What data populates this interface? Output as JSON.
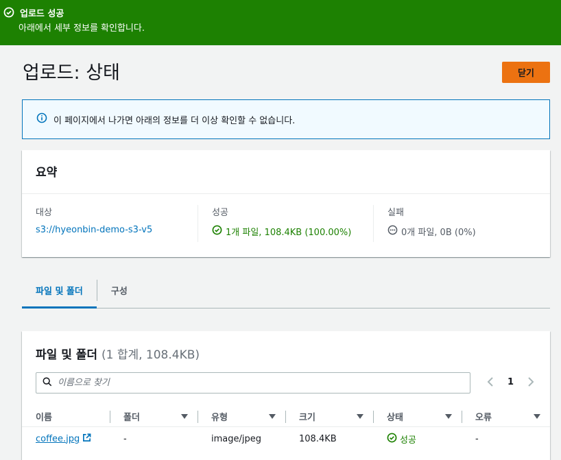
{
  "flash": {
    "title": "업로드 성공",
    "message": "아래에서 세부 정보를 확인합니다."
  },
  "header": {
    "title": "업로드: 상태",
    "close_label": "닫기"
  },
  "info": {
    "message": "이 페이지에서 나가면 아래의 정보를 더 이상 확인할 수 없습니다."
  },
  "summary": {
    "title": "요약",
    "target_label": "대상",
    "target_value": "s3://hyeonbin-demo-s3-v5",
    "success_label": "성공",
    "success_value": "1개 파일, 108.4KB (100.00%)",
    "failure_label": "실패",
    "failure_value": "0개 파일, 0B (0%)"
  },
  "tabs": [
    {
      "label": "파일 및 폴더"
    },
    {
      "label": "구성"
    }
  ],
  "files": {
    "title": "파일 및 폴더",
    "count": "(1 합계, 108.4KB)",
    "search_placeholder": "이름으로 찾기",
    "page": "1",
    "columns": [
      "이름",
      "폴더",
      "유형",
      "크기",
      "상태",
      "오류"
    ],
    "rows": [
      {
        "name": "coffee.jpg",
        "folder": "-",
        "type": "image/jpeg",
        "size": "108.4KB",
        "status": "성공",
        "error": "-"
      }
    ]
  },
  "colors": {
    "success": "#1d8102",
    "primary_button": "#ec7211",
    "link": "#0073bb",
    "info_bg": "#f1faff"
  }
}
